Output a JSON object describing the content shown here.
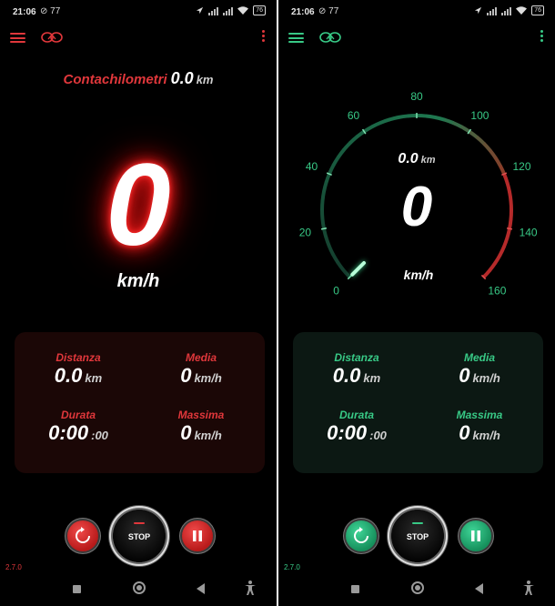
{
  "status_bar": {
    "time": "21:06",
    "notif_count": "77",
    "battery_left": "76",
    "battery_right": "76"
  },
  "colors": {
    "left_accent": "#e0373b",
    "right_accent": "#38c986"
  },
  "icons": [
    "menu-icon",
    "logo-icon",
    "more-vert-icon",
    "reset-icon",
    "pause-icon",
    "location-icon",
    "wifi-icon"
  ],
  "left_screen": {
    "odometer_label": "Contachilometri",
    "odometer_value": "0.0",
    "odometer_unit": "km",
    "speed": "0",
    "speed_unit": "km/h"
  },
  "right_screen": {
    "distance_value": "0.0",
    "distance_unit": "km",
    "speed": "0",
    "speed_unit": "km/h",
    "gauge_ticks": [
      "0",
      "20",
      "40",
      "60",
      "80",
      "100",
      "120",
      "140",
      "160"
    ],
    "gauge_value": 0,
    "gauge_max": 160
  },
  "stats": {
    "distanza_label": "Distanza",
    "distanza_value": "0.0",
    "distanza_unit": "km",
    "media_label": "Media",
    "media_value": "0",
    "media_unit": "km/h",
    "durata_label": "Durata",
    "durata_value": "0:00",
    "durata_seconds": ":00",
    "massima_label": "Massima",
    "massima_value": "0",
    "massima_unit": "km/h"
  },
  "controls": {
    "stop_label": "STOP"
  },
  "version": "2.7.0"
}
